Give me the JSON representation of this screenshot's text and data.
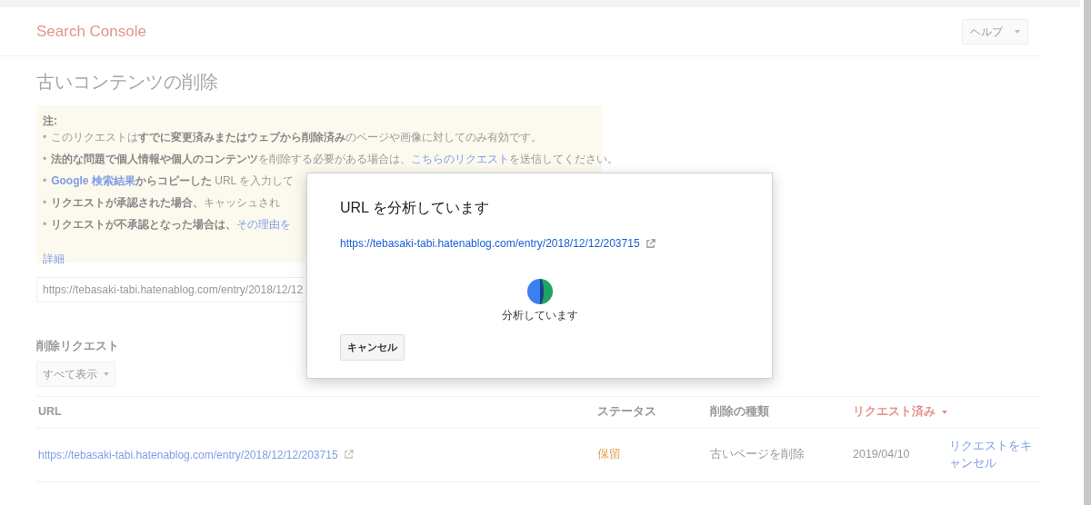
{
  "header": {
    "logo": "Search Console",
    "help_button": "ヘルプ"
  },
  "page_title": "古いコンテンツの削除",
  "note": {
    "heading": "注:",
    "items": [
      {
        "marker": "•",
        "segments": [
          {
            "kind": "plain",
            "text": "このリクエストは"
          },
          {
            "kind": "bold",
            "text": "すでに変更済みまたはウェブから削除済み"
          },
          {
            "kind": "plain",
            "text": "のページや画像に対してのみ有効です。"
          }
        ]
      },
      {
        "marker": "•",
        "segments": [
          {
            "kind": "bold",
            "text": "法的な問題で個人情報や個人のコンテンツ"
          },
          {
            "kind": "plain",
            "text": "を削除する必要がある場合は、"
          },
          {
            "kind": "link",
            "text": "こちらのリクエスト"
          },
          {
            "kind": "plain",
            "text": "を送信してください。"
          }
        ]
      },
      {
        "marker": "•",
        "segments": [
          {
            "kind": "bold_link",
            "text": "Google 検索結果"
          },
          {
            "kind": "bold",
            "text": "からコピーした"
          },
          {
            "kind": "plain",
            "text": " URL を入力して"
          }
        ]
      },
      {
        "marker": "•",
        "segments": [
          {
            "kind": "bold",
            "text": "リクエストが承認された場合、"
          },
          {
            "kind": "plain",
            "text": "キャッシュされ"
          }
        ]
      },
      {
        "marker": "•",
        "segments": [
          {
            "kind": "bold",
            "text": "リクエストが不承認となった場合は、"
          },
          {
            "kind": "link",
            "text": "その理由を"
          }
        ]
      }
    ],
    "details_link": "詳細"
  },
  "url_input": {
    "value": "https://tebasaki-tabi.hatenablog.com/entry/2018/12/12"
  },
  "requests": {
    "heading": "削除リクエスト",
    "filter": "すべて表示",
    "columns": [
      {
        "label": "URL",
        "sorted": false
      },
      {
        "label": "ステータス",
        "sorted": false
      },
      {
        "label": "削除の種類",
        "sorted": false
      },
      {
        "label": "リクエスト済み",
        "sorted": true
      }
    ],
    "rows": [
      {
        "url": "https://tebasaki-tabi.hatenablog.com/entry/2018/12/12/203715",
        "status": "保留",
        "type": "古いページを削除",
        "requested": "2019/04/10",
        "action": "リクエストをキャンセル"
      }
    ]
  },
  "dialog": {
    "title": "URL を分析しています",
    "url": "https://tebasaki-tabi.hatenablog.com/entry/2018/12/12/203715",
    "progress_text": "分析しています",
    "cancel_button": "キャンセル"
  }
}
